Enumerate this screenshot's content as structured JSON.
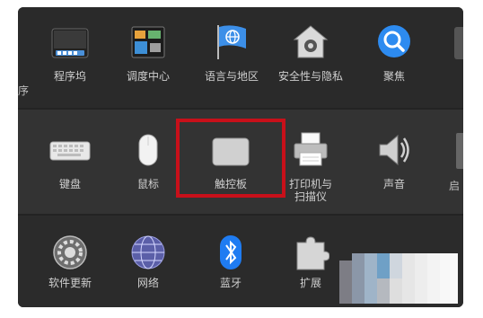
{
  "row1": [
    {
      "name": "dock",
      "label": "程序坞",
      "icon": "dock-icon"
    },
    {
      "name": "mission-control",
      "label": "调度中心",
      "icon": "mission-control-icon"
    },
    {
      "name": "language-region",
      "label": "语言与地区",
      "icon": "flag-globe-icon"
    },
    {
      "name": "security-privacy",
      "label": "安全性与隐私",
      "icon": "house-lock-icon"
    },
    {
      "name": "spotlight",
      "label": "聚焦",
      "icon": "magnifier-icon"
    }
  ],
  "row1_fragment": "序",
  "row2": [
    {
      "name": "keyboard",
      "label": "键盘",
      "icon": "keyboard-icon"
    },
    {
      "name": "mouse",
      "label": "鼠标",
      "icon": "mouse-icon"
    },
    {
      "name": "trackpad",
      "label": "触控板",
      "icon": "trackpad-icon"
    },
    {
      "name": "printers-scanners",
      "label": "打印机与\n扫描仪",
      "icon": "printer-icon"
    },
    {
      "name": "sound",
      "label": "声音",
      "icon": "speaker-icon"
    }
  ],
  "row2_fragment": "启",
  "row3": [
    {
      "name": "software-update",
      "label": "软件更新",
      "icon": "gear-update-icon"
    },
    {
      "name": "network",
      "label": "网络",
      "icon": "network-globe-icon"
    },
    {
      "name": "bluetooth",
      "label": "蓝牙",
      "icon": "bluetooth-icon"
    },
    {
      "name": "extensions",
      "label": "扩展",
      "icon": "puzzle-icon"
    }
  ],
  "colors": {
    "highlight": "#c8101a",
    "bluetooth": "#1f7cf2",
    "spotlight": "#2d8bf0"
  }
}
